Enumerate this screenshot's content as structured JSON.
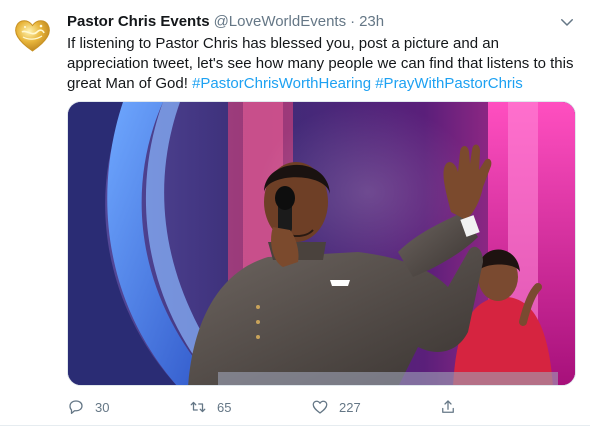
{
  "tweet": {
    "author_name": "Pastor Chris Events",
    "author_handle": "@LoveWorldEvents",
    "separator": "·",
    "time": "23h",
    "text_plain": "If listening to Pastor Chris has blessed you, post a picture and an appreciation tweet, let's see how many people we can find that listens to this great Man of God! ",
    "hashtags": [
      "#PastorChrisWorthHearing",
      "#PrayWithPastorChris"
    ],
    "avatar_icon": "gold-heart-logo-icon",
    "media_description": "photo-preacher-with-microphone"
  },
  "actions": {
    "reply_count": "30",
    "retweet_count": "65",
    "like_count": "227",
    "reply_icon": "reply-bubble-icon",
    "retweet_icon": "retweet-icon",
    "like_icon": "heart-icon",
    "share_icon": "share-icon"
  },
  "colors": {
    "link": "#1da1f2",
    "secondary": "#657786",
    "text": "#14171a"
  }
}
